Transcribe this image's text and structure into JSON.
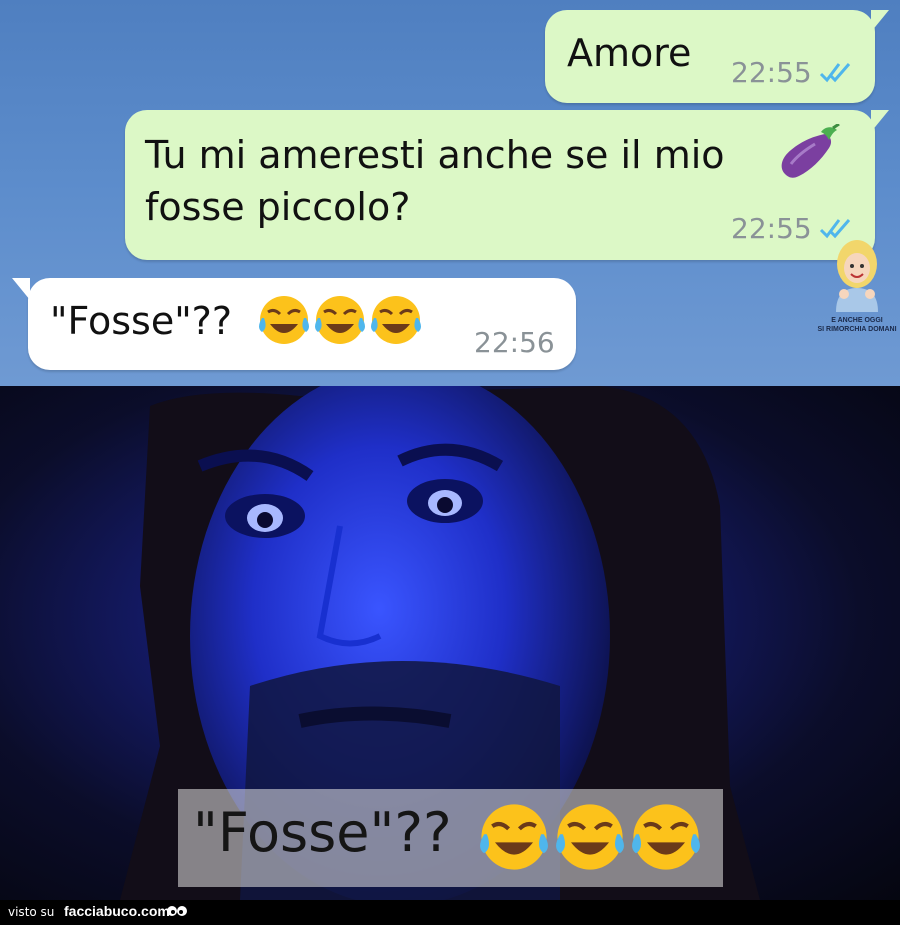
{
  "chat": {
    "messages": [
      {
        "direction": "outgoing",
        "text": "Amore",
        "time": "22:55",
        "status": "read"
      },
      {
        "direction": "outgoing",
        "text_line1": "Tu mi ameresti anche se il mio",
        "text_line2": "fosse piccolo?",
        "emoji": "eggplant",
        "time": "22:55",
        "status": "read"
      },
      {
        "direction": "incoming",
        "text": "\"Fosse\"??",
        "emoji": [
          "laughing-tears",
          "laughing-tears",
          "laughing-tears"
        ],
        "time": "22:56"
      }
    ],
    "colors": {
      "background": "#5d8dcc",
      "outgoing": "#dcf8c6",
      "incoming": "#ffffff",
      "tick": "#4fb6ec"
    }
  },
  "watermark": {
    "line1": "E ANCHE OGGI",
    "line2": "SI RIMORCHIA DOMANI"
  },
  "photo": {
    "caption": "\"Fosse\"??",
    "caption_emoji": [
      "laughing-tears",
      "laughing-tears",
      "laughing-tears"
    ]
  },
  "footer": {
    "prefix": "visto su",
    "site": "facciabuco.com"
  }
}
